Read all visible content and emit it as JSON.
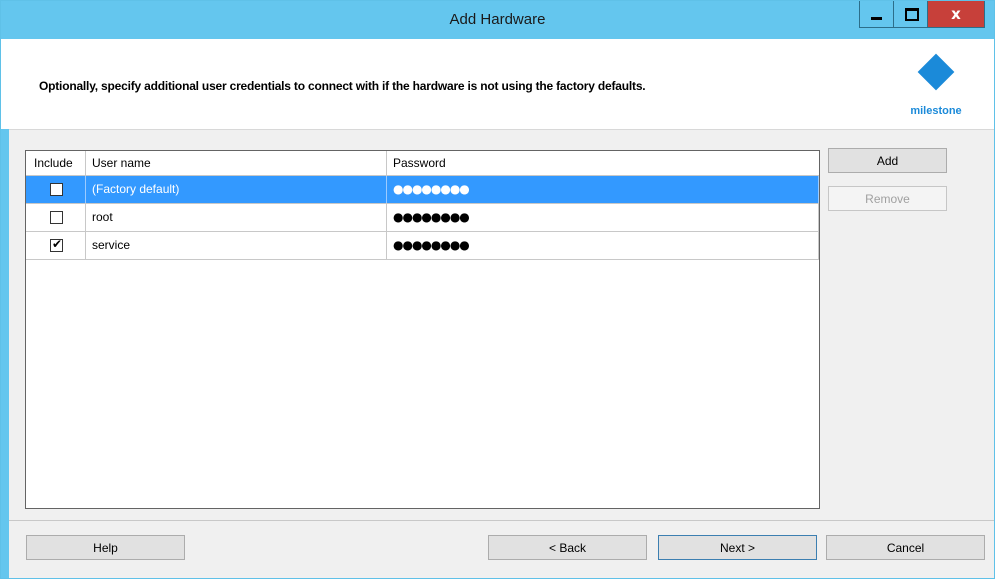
{
  "window": {
    "title": "Add Hardware",
    "title_bar_color": "#64c6ee",
    "buttons": {
      "minimize_icon": "minimize-icon",
      "maximize_icon": "maximize-icon",
      "close_glyph": "x"
    }
  },
  "header": {
    "instruction": "Optionally, specify additional user credentials to connect with if the hardware is not using the factory defaults.",
    "logo_text": "milestone",
    "logo_color": "#1b8ad9"
  },
  "grid": {
    "columns": [
      "Include",
      "User name",
      "Password"
    ],
    "rows": [
      {
        "include": false,
        "user": "(Factory default)",
        "password": "●●●●●●●●",
        "selected": true
      },
      {
        "include": false,
        "user": "root",
        "password": "●●●●●●●●",
        "selected": false
      },
      {
        "include": true,
        "user": "service",
        "password": "●●●●●●●●",
        "selected": false
      }
    ],
    "selection_color": "#3399ff"
  },
  "side_buttons": {
    "add": "Add",
    "remove": "Remove"
  },
  "footer": {
    "help": "Help",
    "back": "< Back",
    "next": "Next >",
    "cancel": "Cancel"
  }
}
